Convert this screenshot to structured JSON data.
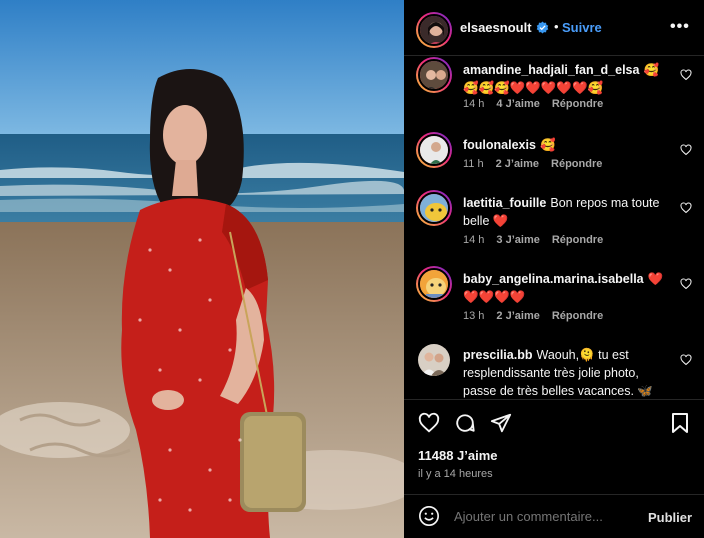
{
  "photo": {
    "description_icon": "photo"
  },
  "header": {
    "username": "elsaesnoult",
    "separator": "•",
    "follow_label": "Suivre",
    "more_label": "•••"
  },
  "comments": [
    {
      "user": "amandine_hadjali_fan_d_elsa",
      "text": "🥰🥰🥰🥰❤️❤️❤️❤️❤️🥰",
      "time": "14 h",
      "likes": "4 J’aime",
      "reply": "Répondre"
    },
    {
      "user": "foulonalexis",
      "text": "🥰",
      "time": "11 h",
      "likes": "2 J’aime",
      "reply": "Répondre"
    },
    {
      "user": "laetitia_fouille",
      "text": "Bon repos ma toute belle ❤️",
      "time": "14 h",
      "likes": "3 J’aime",
      "reply": "Répondre"
    },
    {
      "user": "baby_angelina.marina.isabella",
      "text": "❤️❤️❤️❤️❤️",
      "time": "13 h",
      "likes": "2 J’aime",
      "reply": "Répondre"
    },
    {
      "user": "prescilia.bb",
      "text": "Waouh,🫠 tu est resplendissante très jolie photo, passe de très belles vacances. 🦋 Profite bien avant l’arrivée de",
      "time": "",
      "likes": "",
      "reply": ""
    }
  ],
  "actions": {
    "likes": "11488 J’aime",
    "time": "il y a 14 heures"
  },
  "add_comment": {
    "placeholder": "Ajouter un commentaire...",
    "publish": "Publier"
  },
  "colors": {
    "accent": "#4a9dfa",
    "background": "#000000",
    "secondary_text": "#a8a8a8",
    "divider": "#262626"
  }
}
